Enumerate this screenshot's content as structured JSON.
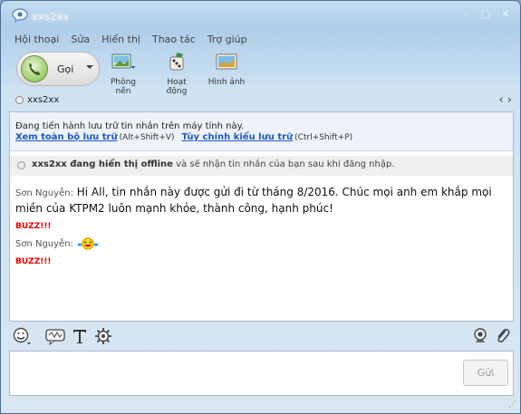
{
  "window": {
    "title": "xxs2xx",
    "controls": [
      "–",
      "□",
      "✕"
    ]
  },
  "menu": [
    "Hội thoại",
    "Sửa",
    "Hiển thị",
    "Thao tác",
    "Trợ giúp"
  ],
  "toolbar": {
    "call_label": "Gọi",
    "tools": [
      {
        "label": "Phông nền",
        "icon": "background-icon"
      },
      {
        "label": "Hoạt động",
        "icon": "activities-icon"
      },
      {
        "label": "Hình ảnh",
        "icon": "photo-icon"
      }
    ]
  },
  "contact": {
    "name": "xxs2xx",
    "nav": "‹ ›"
  },
  "notice": {
    "text": "Đang tiến hành lưu trữ tin nhắn trên máy tính này.",
    "link1": "Xem toàn bộ lưu trữ",
    "shortcut1": "(Alt+Shift+V)",
    "link2": "Tùy chỉnh kiểu lưu trữ",
    "shortcut2": "(Ctrl+Shift+P)"
  },
  "offline": {
    "name": "xxs2xx đang hiển thị offline",
    "rest": " và sẽ nhận tin nhắn của bạn sau khi đăng nhập."
  },
  "messages": [
    {
      "sender": "Sơn Nguyễn:",
      "text": " Hi All, tin nhắn này được gửi đi từ tháng 8/2016. Chúc mọi anh em khắp mọi miền của KTPM2 luôn mạnh khỏe, thành công, hạnh phúc!"
    },
    {
      "buzz": "BUZZ!!!"
    },
    {
      "sender": "Sơn Nguyễn:",
      "emoji": "laughing-emoji-icon"
    },
    {
      "buzz": "BUZZ!!!"
    }
  ],
  "input": {
    "send_label": "Gửi",
    "value": ""
  },
  "colors": {
    "link": "#1c58c8",
    "buzz": "#e00000",
    "titlebar": "#aecde9"
  }
}
